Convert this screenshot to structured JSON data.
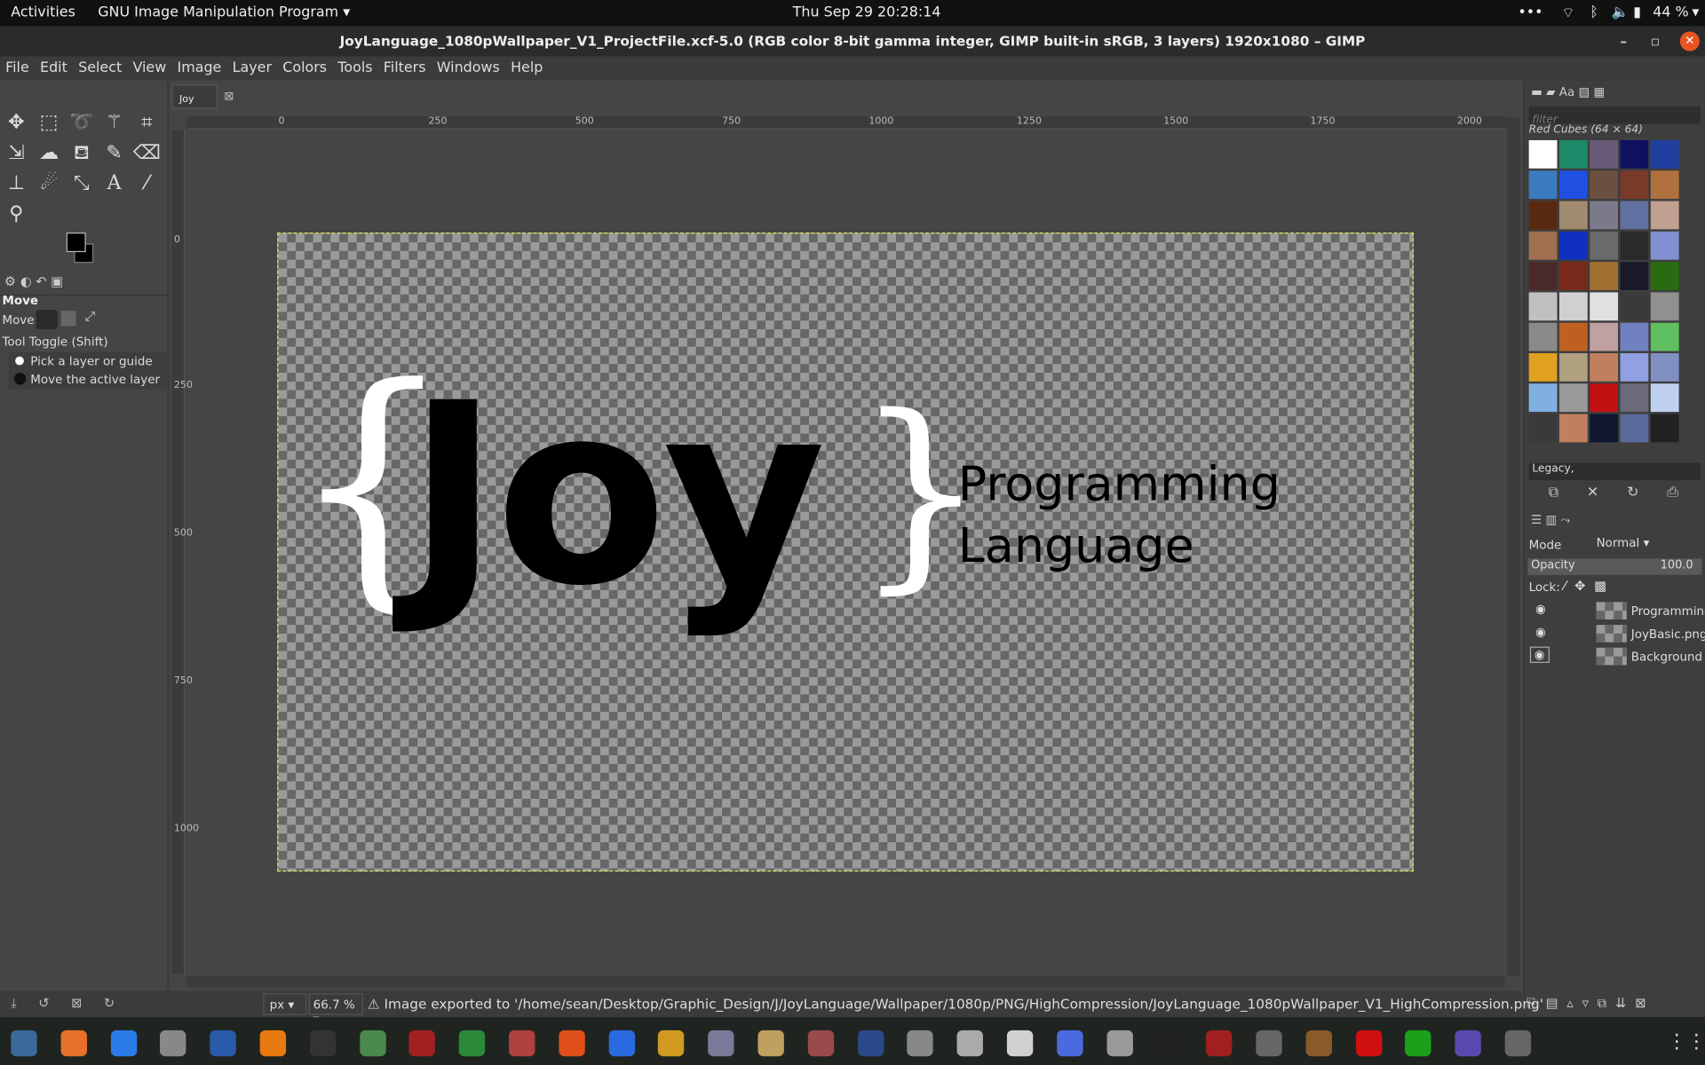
{
  "topbar": {
    "activities": "Activities",
    "app": "GNU Image Manipulation Program",
    "datetime": "Thu Sep 29  20:28:14",
    "battery": "44 %"
  },
  "window": {
    "title": "JoyLanguage_1080pWallpaper_V1_ProjectFile.xcf-5.0 (RGB color 8-bit gamma integer, GIMP built-in sRGB, 3 layers) 1920x1080 – GIMP"
  },
  "menu": [
    "File",
    "Edit",
    "Select",
    "View",
    "Image",
    "Layer",
    "Colors",
    "Tools",
    "Filters",
    "Windows",
    "Help"
  ],
  "image_tab": "Joy",
  "tool_options": {
    "title": "Move",
    "move_label": "Move:",
    "toggle": "Tool Toggle  (Shift)",
    "opt1": "Pick a layer or guide",
    "opt2": "Move the active layer"
  },
  "ruler": {
    "h": [
      "0",
      "250",
      "500",
      "750",
      "1000",
      "1250",
      "1500",
      "1750",
      "2000"
    ],
    "v": [
      "0",
      "250",
      "500",
      "750",
      "1000"
    ]
  },
  "artwork": {
    "joy": "Joy",
    "lbrace": "{",
    "rbrace": "}",
    "line1": "Programming",
    "line2": "Language"
  },
  "patterns": {
    "filter_placeholder": "filter",
    "name": "Red Cubes (64 × 64)",
    "tag": "Legacy,"
  },
  "layers": {
    "mode_label": "Mode",
    "mode": "Normal",
    "opacity_label": "Opacity",
    "opacity": "100.0",
    "lock_label": "Lock:",
    "items": [
      "Programming",
      "JoyBasic.png",
      "Background"
    ]
  },
  "status": {
    "unit": "px",
    "zoom": "66.7 %",
    "message": "Image exported to '/home/sean/Desktop/Graphic_Design/J/JoyLanguage/Wallpaper/1080p/PNG/HighCompression/JoyLanguage_1080pWallpaper_V1_HighCompression.png'"
  },
  "icons": [
    "move-icon",
    "rect-select-icon",
    "lasso-icon",
    "fuzzy-select-icon",
    "crop-icon",
    "transform-icon",
    "warp-icon",
    "bucket-icon",
    "paintbrush-icon",
    "eraser-icon",
    "clone-icon",
    "smudge-icon",
    "path-icon",
    "text-icon",
    "color-picker-icon",
    "zoom-icon"
  ],
  "colors": {
    "fg": "#000000",
    "bg": "#000000",
    "close": "#e95420"
  }
}
